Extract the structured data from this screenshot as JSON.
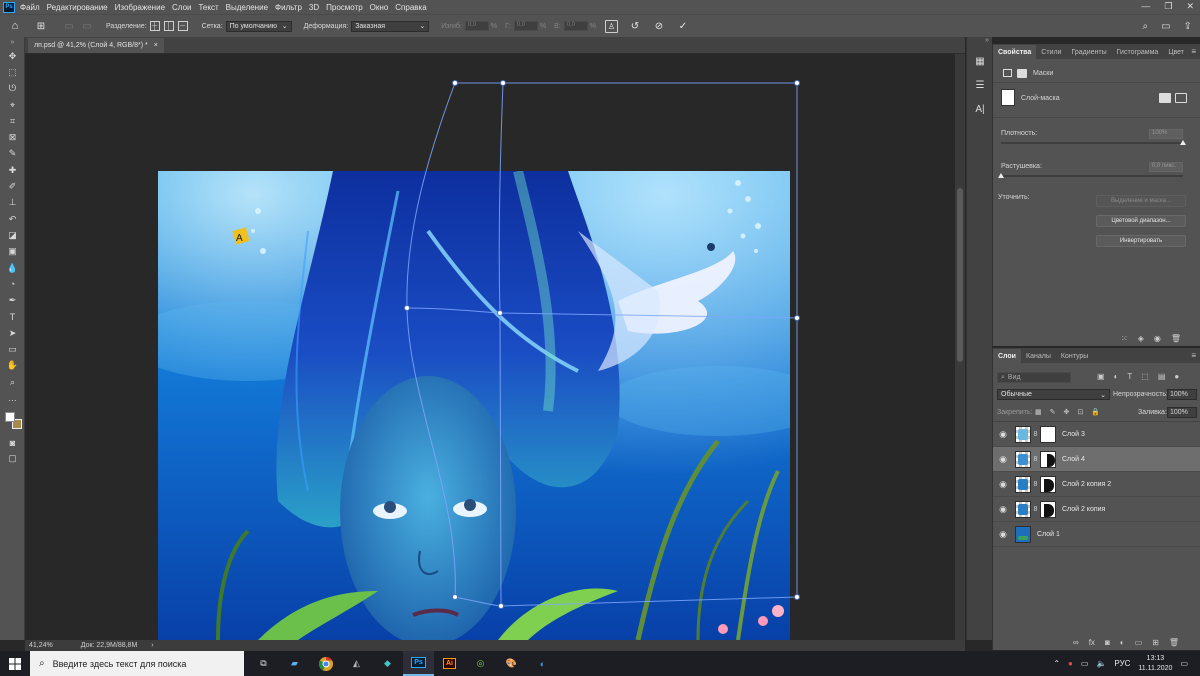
{
  "app": {
    "logo": "Ps",
    "menu": [
      "Файл",
      "Редактирование",
      "Изображение",
      "Слои",
      "Текст",
      "Выделение",
      "Фильтр",
      "3D",
      "Просмотр",
      "Окно",
      "Справка"
    ],
    "window_controls": {
      "minimize": "—",
      "restore": "❐",
      "close": "✕"
    }
  },
  "options": {
    "split_label": "Разделение:",
    "grid_label": "Сетка:",
    "grid_value": "По умолчанию",
    "warp_label": "Деформация:",
    "warp_value": "Заказная",
    "bend_label": "Изгиб:",
    "bend_value": "0,0",
    "h_label": "Г:",
    "h_value": "0,0",
    "v_label": "В:",
    "v_value": "0,0",
    "percent": "%",
    "undo_icon": "↺",
    "cancel_icon": "⊘",
    "confirm_icon": "✓"
  },
  "document": {
    "tab_title": "лп.psd @ 41,2% (Слой 4, RGB/8*) *",
    "tab_close": "×",
    "collapse": "»"
  },
  "status": {
    "zoom": "41,24%",
    "doc_size": "Док: 22,9M/88,8M",
    "arrow": "›"
  },
  "properties": {
    "tabs": [
      "Свойства",
      "Стили",
      "Градиенты",
      "Гистограмма",
      "Цвет"
    ],
    "masks_label": "Маски",
    "layer_mask_label": "Слой-маска",
    "density_label": "Плотность:",
    "density_value": "100%",
    "density_level": 1.0,
    "feather_label": "Растушевка:",
    "feather_value": "0,0 пикс.",
    "feather_level": 0.0,
    "refine_label": "Уточнить:",
    "btn_select_mask": "Выделение и маска...",
    "btn_color_range": "Цветовой диапазон...",
    "btn_invert": "Инвертировать"
  },
  "layers": {
    "tabs": [
      "Слои",
      "Каналы",
      "Контуры"
    ],
    "search_placeholder": "Вид",
    "blend_mode": "Обычные",
    "opacity_label": "Непрозрачность:",
    "opacity_value": "100%",
    "lock_label": "Закрепить:",
    "fill_label": "Заливка:",
    "fill_value": "100%",
    "rows": [
      {
        "name": "Слой 3",
        "visible": true,
        "mask": true,
        "selected": false
      },
      {
        "name": "Слой 4",
        "visible": true,
        "mask": true,
        "selected": true
      },
      {
        "name": "Слой 2 копия 2",
        "visible": true,
        "mask": true,
        "selected": false
      },
      {
        "name": "Слой 2 копия",
        "visible": true,
        "mask": true,
        "selected": false
      },
      {
        "name": "Слой 1",
        "visible": true,
        "mask": false,
        "selected": false
      }
    ]
  },
  "taskbar": {
    "search_placeholder": "Введите здесь текст для поиска",
    "lang": "РУС",
    "time": "13:13",
    "date": "11.11.2020",
    "ai_label": "Ai",
    "ps_label": "Ps"
  }
}
